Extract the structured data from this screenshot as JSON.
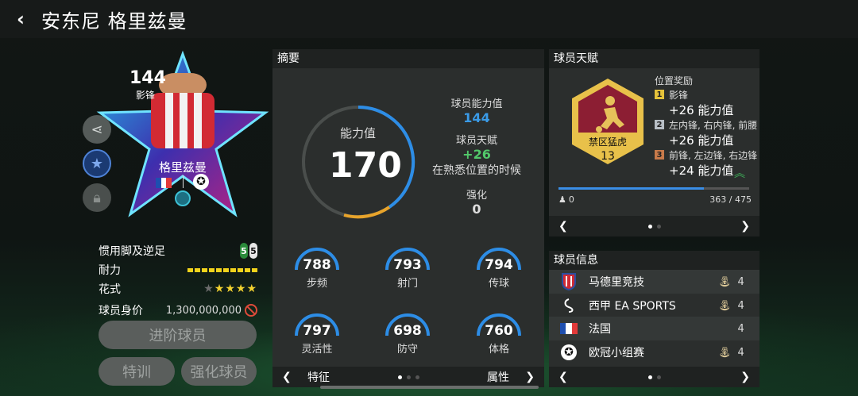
{
  "header": {
    "title": "安东尼 格里兹曼"
  },
  "card": {
    "rating": "144",
    "position": "影锋",
    "name": "格里兹曼"
  },
  "attrs": [
    {
      "label": "惯用脚及逆足",
      "value_a": "5",
      "value_b": "5"
    },
    {
      "label": "耐力"
    },
    {
      "label": "花式"
    },
    {
      "label": "球员身价",
      "value": "1,300,000,000"
    }
  ],
  "buttons": {
    "advance": "进阶球员",
    "training": "特训",
    "upgrade": "强化球员"
  },
  "summary": {
    "title": "摘要",
    "ring_label": "能力值",
    "ring_value": "170",
    "info": [
      {
        "label": "球员能力值",
        "value": "144"
      },
      {
        "label": "球员天赋",
        "value": "+26",
        "note": "在熟悉位置的时候"
      },
      {
        "label": "强化",
        "value": "0"
      }
    ],
    "stats": [
      {
        "value": "788",
        "name": "步频"
      },
      {
        "value": "793",
        "name": "射门"
      },
      {
        "value": "794",
        "name": "传球"
      },
      {
        "value": "797",
        "name": "灵活性"
      },
      {
        "value": "698",
        "name": "防守"
      },
      {
        "value": "760",
        "name": "体格"
      }
    ],
    "nav_left": "特征",
    "nav_right": "属性"
  },
  "talent": {
    "title": "球员天赋",
    "badge_name": "禁区猛虎",
    "badge_level": "13",
    "bonus_title": "位置奖励",
    "bonus": [
      {
        "num": "1",
        "positions": "影锋",
        "plus": "+26 能力值"
      },
      {
        "num": "2",
        "positions": "左内锋, 右内锋, 前腰",
        "plus": "+26 能力值"
      },
      {
        "num": "3",
        "positions": "前锋, 左边锋, 右边锋",
        "plus": "+24 能力值"
      }
    ],
    "progress_start": "0",
    "progress_text": "363 / 475",
    "progress_current": 363,
    "progress_max": 475
  },
  "info": {
    "title": "球员信息",
    "rows": [
      {
        "name": "马德里竞技",
        "level": "4"
      },
      {
        "name": "西甲 EA SPORTS",
        "level": "4"
      },
      {
        "name": "法国",
        "level": "4"
      },
      {
        "name": "欧冠小组赛",
        "level": "4"
      }
    ]
  },
  "colors": {
    "accent_blue": "#2d8de6",
    "accent_orange": "#e8a42b",
    "talent_green": "#52c96a"
  }
}
